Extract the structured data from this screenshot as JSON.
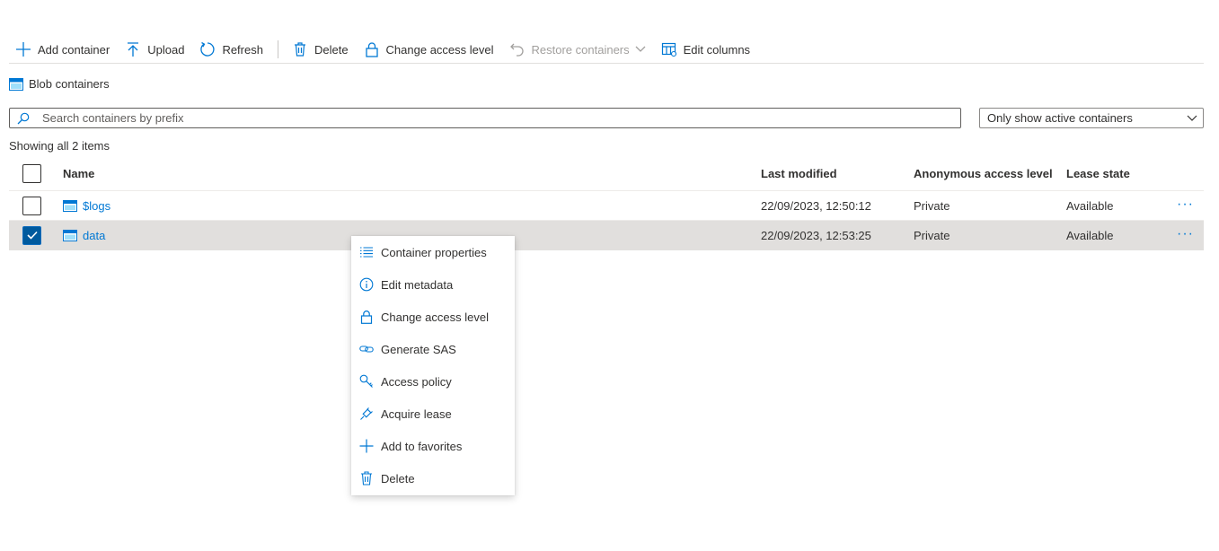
{
  "toolbar": {
    "add_container": "Add container",
    "upload": "Upload",
    "refresh": "Refresh",
    "delete": "Delete",
    "change_access_level": "Change access level",
    "restore_containers": "Restore containers",
    "edit_columns": "Edit columns"
  },
  "section": {
    "title": "Blob containers"
  },
  "search": {
    "placeholder": "Search containers by prefix",
    "value": ""
  },
  "filter": {
    "selected": "Only show active containers"
  },
  "status": {
    "count_text": "Showing all 2 items"
  },
  "table": {
    "columns": {
      "name": "Name",
      "last_modified": "Last modified",
      "access_level": "Anonymous access level",
      "lease_state": "Lease state"
    },
    "rows": [
      {
        "name": "$logs",
        "last_modified": "22/09/2023, 12:50:12",
        "access_level": "Private",
        "lease_state": "Available",
        "more": "···",
        "selected": false
      },
      {
        "name": "data",
        "last_modified": "22/09/2023, 12:53:25",
        "access_level": "Private",
        "lease_state": "Available",
        "more": "···",
        "selected": true
      }
    ]
  },
  "context_menu": {
    "items": [
      {
        "label": "Container properties",
        "icon": "list-icon"
      },
      {
        "label": "Edit metadata",
        "icon": "info-icon"
      },
      {
        "label": "Change access level",
        "icon": "lock-icon"
      },
      {
        "label": "Generate SAS",
        "icon": "link-icon"
      },
      {
        "label": "Access policy",
        "icon": "key-icon"
      },
      {
        "label": "Acquire lease",
        "icon": "plug-icon"
      },
      {
        "label": "Add to favorites",
        "icon": "plus-icon"
      },
      {
        "label": "Delete",
        "icon": "trash-icon"
      }
    ]
  },
  "colors": {
    "accent": "#0078d4",
    "text": "#323130",
    "disabled": "#a19f9d",
    "selected_row": "#e1dfdd"
  }
}
